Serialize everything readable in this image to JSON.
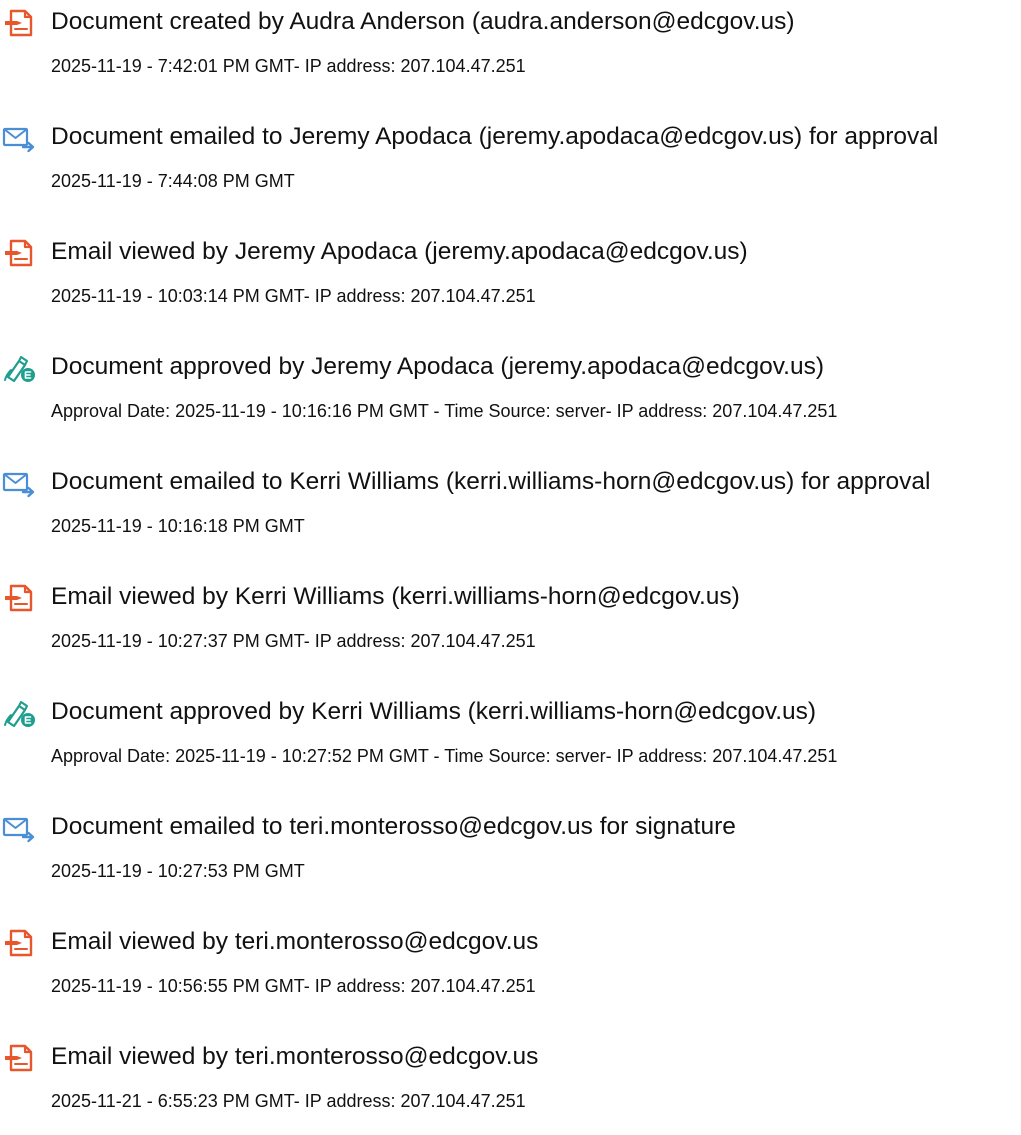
{
  "colors": {
    "document_icon": "#e8572c",
    "email_icon": "#4a8fd6",
    "approve_icon": "#1e9e8e",
    "text": "#111111"
  },
  "events": [
    {
      "icon": "document-icon",
      "title": "Document created by Audra Anderson (audra.anderson@edcgov.us)",
      "detail": "2025-11-19 - 7:42:01 PM GMT- IP address: 207.104.47.251"
    },
    {
      "icon": "email-sent-icon",
      "title": "Document emailed to Jeremy Apodaca (jeremy.apodaca@edcgov.us) for approval",
      "detail": "2025-11-19 - 7:44:08 PM GMT"
    },
    {
      "icon": "document-icon",
      "title": "Email viewed by Jeremy Apodaca (jeremy.apodaca@edcgov.us)",
      "detail": "2025-11-19 - 10:03:14 PM GMT- IP address: 207.104.47.251"
    },
    {
      "icon": "approve-pen-icon",
      "title": "Document approved by Jeremy Apodaca (jeremy.apodaca@edcgov.us)",
      "detail": "Approval Date: 2025-11-19 - 10:16:16 PM GMT - Time Source: server- IP address: 207.104.47.251"
    },
    {
      "icon": "email-sent-icon",
      "title": "Document emailed to Kerri Williams (kerri.williams-horn@edcgov.us) for approval",
      "detail": "2025-11-19 - 10:16:18 PM GMT"
    },
    {
      "icon": "document-icon",
      "title": "Email viewed by Kerri Williams (kerri.williams-horn@edcgov.us)",
      "detail": "2025-11-19 - 10:27:37 PM GMT- IP address: 207.104.47.251"
    },
    {
      "icon": "approve-pen-icon",
      "title": "Document approved by Kerri Williams (kerri.williams-horn@edcgov.us)",
      "detail": "Approval Date: 2025-11-19 - 10:27:52 PM GMT - Time Source: server- IP address: 207.104.47.251"
    },
    {
      "icon": "email-sent-icon",
      "title": "Document emailed to teri.monterosso@edcgov.us for signature",
      "detail": "2025-11-19 - 10:27:53 PM GMT"
    },
    {
      "icon": "document-icon",
      "title": "Email viewed by teri.monterosso@edcgov.us",
      "detail": "2025-11-19 - 10:56:55 PM GMT- IP address: 207.104.47.251"
    },
    {
      "icon": "document-icon",
      "title": "Email viewed by teri.monterosso@edcgov.us",
      "detail": "2025-11-21 - 6:55:23 PM GMT- IP address: 207.104.47.251"
    }
  ]
}
